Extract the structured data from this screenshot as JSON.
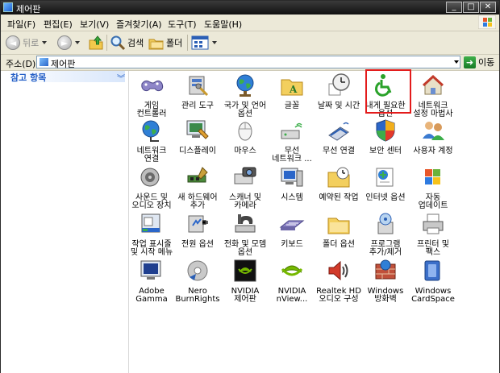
{
  "window": {
    "title": "제어판",
    "minimize": "_",
    "maximize": "□",
    "close": "✕"
  },
  "menu": [
    "파일(F)",
    "편집(E)",
    "보기(V)",
    "즐겨찾기(A)",
    "도구(T)",
    "도움말(H)"
  ],
  "toolbar": {
    "back": "뒤로",
    "search": "검색",
    "folders": "폴더"
  },
  "address": {
    "label": "주소(D)",
    "value": "제어판",
    "go": "이동"
  },
  "left_pane": {
    "header": "참고 항목"
  },
  "items": [
    {
      "label": "게임\n컨트롤러",
      "icon": "game-controller-icon"
    },
    {
      "label": "관리 도구",
      "icon": "admin-tools-icon"
    },
    {
      "label": "국가 및 언어\n옵션",
      "icon": "globe-icon"
    },
    {
      "label": "글꼴",
      "icon": "fonts-folder-icon"
    },
    {
      "label": "날짜 및 시간",
      "icon": "clock-icon"
    },
    {
      "label": "내게 필요한\n옵션",
      "icon": "accessibility-icon"
    },
    {
      "label": "네트워크\n설정 마법사",
      "icon": "network-wizard-icon"
    },
    {
      "label": "네트워크\n연결",
      "icon": "network-globe-icon"
    },
    {
      "label": "디스플레이",
      "icon": "display-icon"
    },
    {
      "label": "마우스",
      "icon": "mouse-icon"
    },
    {
      "label": "무선\n네트워크 ...",
      "icon": "wireless-network-icon"
    },
    {
      "label": "무선 연결",
      "icon": "wireless-link-icon"
    },
    {
      "label": "보안 센터",
      "icon": "security-shield-icon"
    },
    {
      "label": "사용자 계정",
      "icon": "user-accounts-icon"
    },
    {
      "label": "사운드 및\n오디오 장치",
      "icon": "speaker-icon"
    },
    {
      "label": "새 하드웨어\n추가",
      "icon": "add-hardware-icon"
    },
    {
      "label": "스캐너 및\n카메라",
      "icon": "scanner-camera-icon"
    },
    {
      "label": "시스템",
      "icon": "system-icon"
    },
    {
      "label": "예약된 작업",
      "icon": "scheduled-tasks-icon"
    },
    {
      "label": "인터넷 옵션",
      "icon": "internet-options-icon"
    },
    {
      "label": "자동\n업데이트",
      "icon": "windows-update-icon"
    },
    {
      "label": "작업 표시줄\n및 시작 메뉴",
      "icon": "taskbar-icon"
    },
    {
      "label": "전원 옵션",
      "icon": "power-options-icon"
    },
    {
      "label": "전화 및 모뎀\n옵션",
      "icon": "phone-modem-icon"
    },
    {
      "label": "키보드",
      "icon": "keyboard-icon"
    },
    {
      "label": "폴더 옵션",
      "icon": "folder-options-icon"
    },
    {
      "label": "프로그램\n추가/제거",
      "icon": "add-remove-programs-icon"
    },
    {
      "label": "프린터 및\n팩스",
      "icon": "printer-fax-icon"
    },
    {
      "label": "Adobe\nGamma",
      "icon": "adobe-gamma-icon"
    },
    {
      "label": "Nero\nBurnRights",
      "icon": "nero-icon"
    },
    {
      "label": "NVIDIA\n제어판",
      "icon": "nvidia-control-icon"
    },
    {
      "label": "NVIDIA\nnView...",
      "icon": "nvidia-nview-icon"
    },
    {
      "label": "Realtek HD\n오디오 구성",
      "icon": "realtek-audio-icon"
    },
    {
      "label": "Windows\n방화벽",
      "icon": "firewall-icon"
    },
    {
      "label": "Windows\nCardSpace",
      "icon": "cardspace-icon"
    }
  ],
  "highlighted_item": "내게 필요한 옵션"
}
